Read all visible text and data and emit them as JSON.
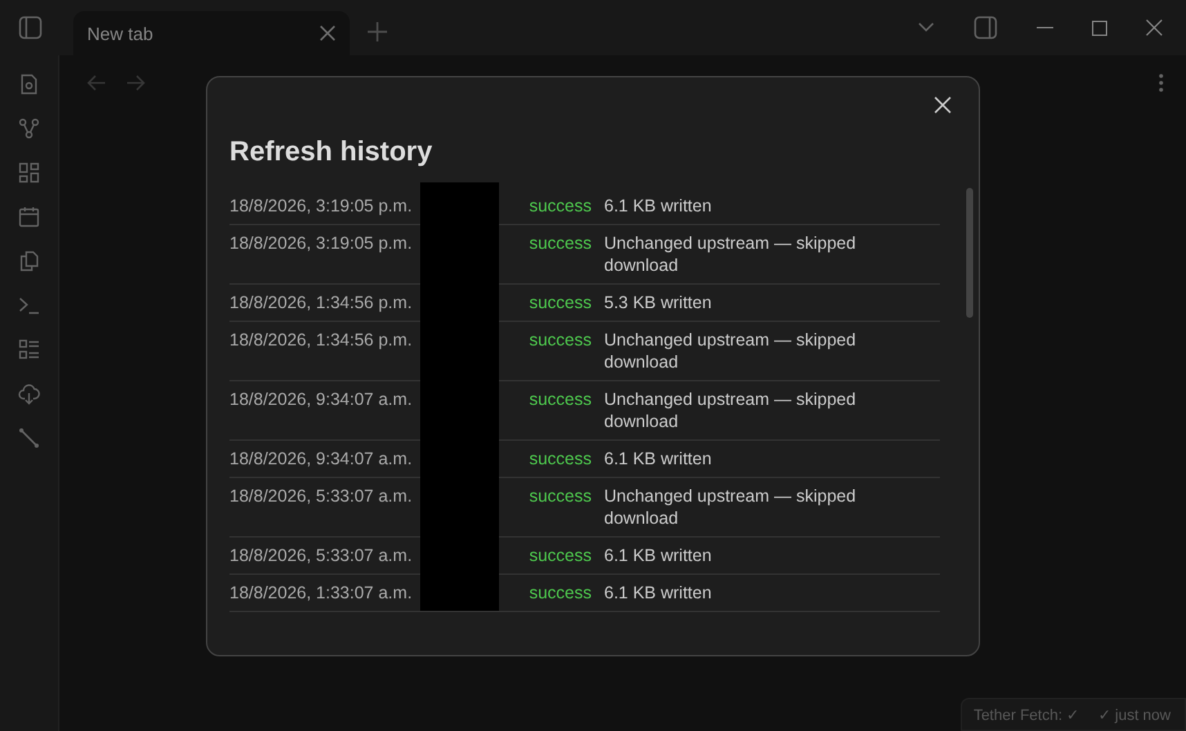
{
  "tabs": [
    {
      "label": "New tab",
      "selected": true
    }
  ],
  "dialog": {
    "title": "Refresh history",
    "rows": [
      {
        "time": "18/8/2026, 3:19:05 p.m.",
        "status": "success",
        "message": "6.1 KB written"
      },
      {
        "time": "18/8/2026, 3:19:05 p.m.",
        "status": "success",
        "message": "Unchanged upstream — skipped download"
      },
      {
        "time": "18/8/2026, 1:34:56 p.m.",
        "status": "success",
        "message": "5.3 KB written"
      },
      {
        "time": "18/8/2026, 1:34:56 p.m.",
        "status": "success",
        "message": "Unchanged upstream — skipped download"
      },
      {
        "time": "18/8/2026, 9:34:07 a.m.",
        "status": "success",
        "message": "Unchanged upstream — skipped download"
      },
      {
        "time": "18/8/2026, 9:34:07 a.m.",
        "status": "success",
        "message": "6.1 KB written"
      },
      {
        "time": "18/8/2026, 5:33:07 a.m.",
        "status": "success",
        "message": "Unchanged upstream — skipped download"
      },
      {
        "time": "18/8/2026, 5:33:07 a.m.",
        "status": "success",
        "message": "6.1 KB written"
      },
      {
        "time": "18/8/2026, 1:33:07 a.m.",
        "status": "success",
        "message": "6.1 KB written"
      }
    ]
  },
  "status_bar": {
    "plugin": "Tether Fetch: ✓",
    "sync": "✓ just now"
  }
}
